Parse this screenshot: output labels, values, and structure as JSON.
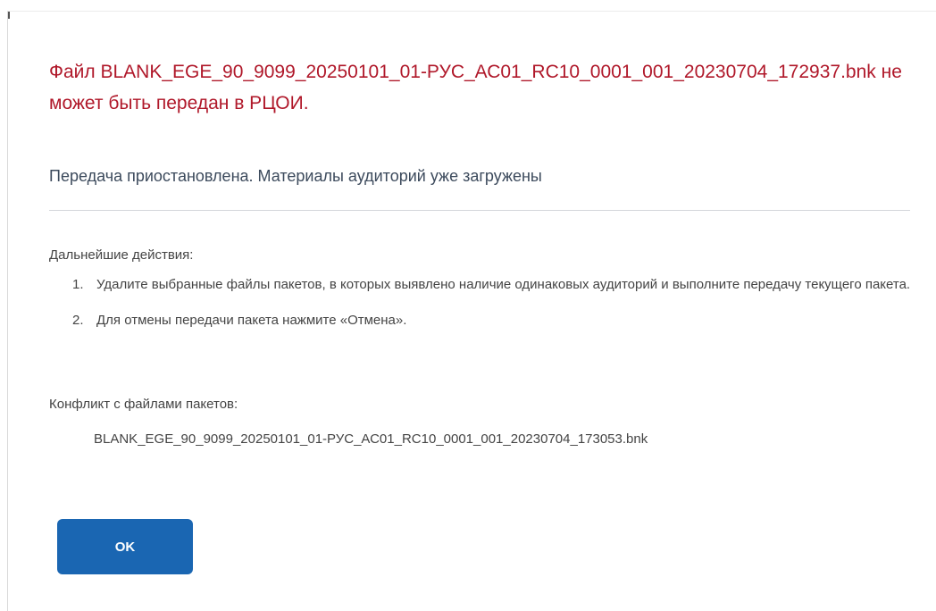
{
  "dialog": {
    "error_title": "Файл BLANK_EGE_90_9099_20250101_01-РУС_АС01_RC10_0001_001_20230704_172937.bnk не может быть передан в РЦОИ.",
    "subtitle": "Передача приостановлена. Материалы аудиторий уже загружены",
    "next_steps_label": "Дальнейшие действия:",
    "steps": [
      {
        "number": "1.",
        "text": "Удалите выбранные файлы пакетов, в которых выявлено наличие одинаковых аудиторий и выполните передачу текущего пакета."
      },
      {
        "number": "2.",
        "text": "Для отмены передачи пакета нажмите «Отмена»."
      }
    ],
    "conflict_label": "Конфликт с файлами пакетов:",
    "conflict_files": [
      "BLANK_EGE_90_9099_20250101_01-РУС_АС01_RC10_0001_001_20230704_173053.bnk"
    ],
    "ok_label": "OK"
  },
  "colors": {
    "error_text": "#b0182a",
    "subtitle_text": "#3c4a5c",
    "body_text": "#444444",
    "button_bg": "#1a66b2",
    "button_text": "#ffffff",
    "divider": "#d3d6da"
  }
}
